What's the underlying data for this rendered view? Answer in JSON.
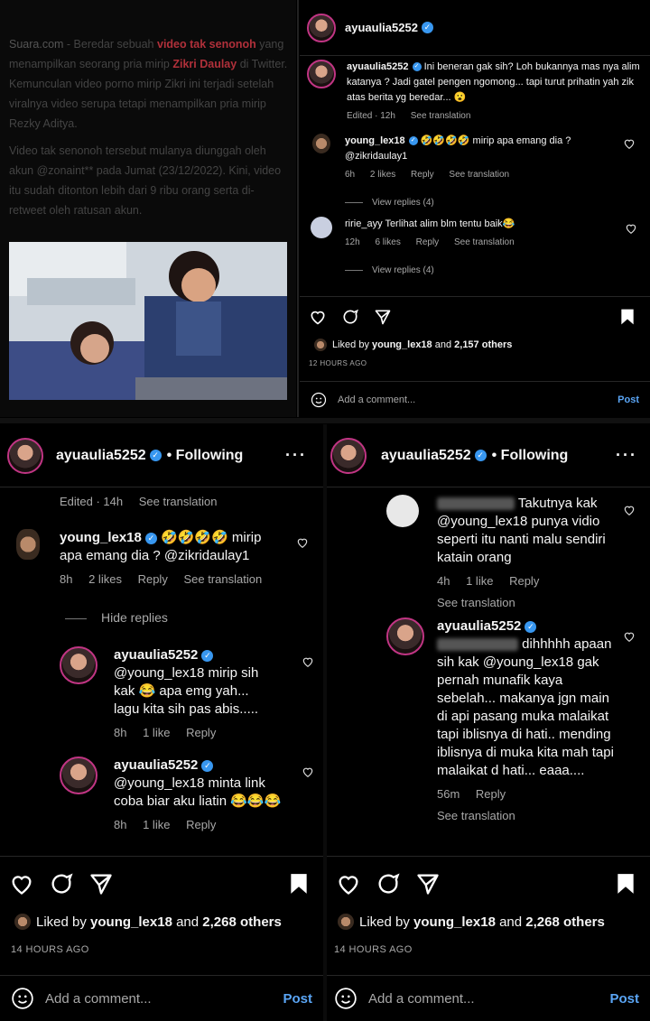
{
  "article": {
    "source": "Suara.com",
    "p1_a": " - Beredar sebuah ",
    "p1_red1": "video tak senonoh",
    "p1_b": " yang menampilkan seorang pria mirip ",
    "p1_red2": "Zikri Daulay",
    "p1_c": " di Twitter. Kemunculan video porno mirip Zikri ini terjadi setelah viralnya video serupa tetapi menampilkan pria mirip Rezky Aditya.",
    "p2": "Video tak senonoh tersebut mulanya diunggah oleh akun @zonaint** pada Jumat (23/12/2022). Kini, video itu sudah ditonton lebih dari 9 ribu orang serta di-retweet oleh ratusan akun."
  },
  "top_post": {
    "owner": "ayuaulia5252",
    "caption_user": "ayuaulia5252",
    "caption_text": "Ini beneran gak sih? Loh bukannya mas nya alim katanya ? Jadi gatel pengen ngomong... tapi turut prihatin yah zik atas berita yg beredar... 😮",
    "caption_meta": [
      "Edited · 12h",
      "See translation"
    ],
    "comments": [
      {
        "user": "young_lex18",
        "text": "🤣🤣🤣🤣 mirip apa emang dia ? @zikridaulay1",
        "meta": [
          "6h",
          "2 likes",
          "Reply",
          "See translation"
        ],
        "replies": "View replies (4)"
      },
      {
        "user": "ririe_ayy",
        "text": "Terlihat alim blm tentu baik😂",
        "meta": [
          "12h",
          "6 likes",
          "Reply",
          "See translation"
        ],
        "replies": "View replies (4)"
      }
    ],
    "liked_by": "young_lex18",
    "liked_others": "2,157 others",
    "time_ago": "12 HOURS AGO",
    "add_comment": "Add a comment...",
    "post_label": "Post"
  },
  "bottom_left": {
    "owner": "ayuaulia5252",
    "following": "• Following",
    "caption_meta": [
      "Edited · 14h",
      "See translation"
    ],
    "comment": {
      "user": "young_lex18",
      "text": "🤣🤣🤣🤣 mirip apa emang dia ? @zikridaulay1",
      "meta": [
        "8h",
        "2 likes",
        "Reply",
        "See translation"
      ]
    },
    "hide_replies": "Hide replies",
    "replies": [
      {
        "user": "ayuaulia5252",
        "text": "@young_lex18 mirip sih kak 😂 apa emg yah... lagu kita sih pas abis.....",
        "meta": [
          "8h",
          "1 like",
          "Reply"
        ]
      },
      {
        "user": "ayuaulia5252",
        "text": "@young_lex18 minta link coba biar aku liatin 😂😂😂",
        "meta": [
          "8h",
          "1 like",
          "Reply"
        ]
      }
    ],
    "liked_by": "young_lex18",
    "liked_others": "2,268 others",
    "time_ago": "14 HOURS AGO",
    "add_comment": "Add a comment...",
    "post_label": "Post"
  },
  "bottom_right": {
    "owner": "ayuaulia5252",
    "following": "• Following",
    "comment1": {
      "text": "Takutnya kak @young_lex18 punya vidio seperti itu nanti malu sendiri katain orang",
      "meta": [
        "4h",
        "1 like",
        "Reply"
      ],
      "see_translation": "See translation"
    },
    "comment2": {
      "user": "ayuaulia5252",
      "text": "dihhhhh apaan sih kak @young_lex18 gak pernah munafik kaya sebelah... makanya jgn main di api pasang muka malaikat tapi iblisnya di hati.. mending iblisnya di muka kita mah tapi malaikat d hati... eaaa....",
      "meta": [
        "56m",
        "Reply"
      ],
      "see_translation": "See translation"
    },
    "liked_by": "young_lex18",
    "liked_others": "2,268 others",
    "time_ago": "14 HOURS AGO",
    "add_comment": "Add a comment...",
    "post_label": "Post"
  },
  "icons": [
    "heart-icon",
    "comment-icon",
    "share-icon",
    "bookmark-icon",
    "emoji-icon",
    "more-icon",
    "verified-icon"
  ],
  "colors": {
    "accent": "#3897f0",
    "link": "#5aa5f5",
    "headline_red": "#b0303a"
  }
}
